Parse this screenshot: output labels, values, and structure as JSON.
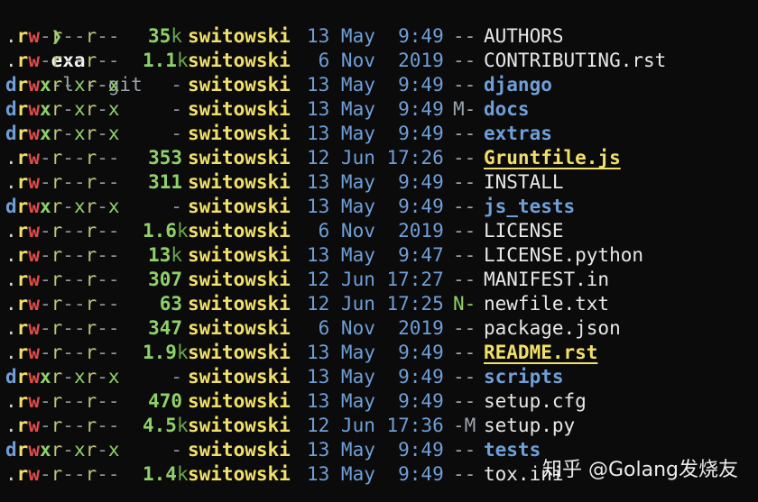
{
  "prompt": {
    "symbol": "❯",
    "command": "exa",
    "args": "-l --git"
  },
  "rows": [
    {
      "type": ".",
      "perms": "rw-r--r--",
      "size": "35",
      "unit": "k",
      "user": "switowski",
      "date": "13 May  9:49",
      "git": "--",
      "name": "AUTHORS",
      "kind": "file"
    },
    {
      "type": ".",
      "perms": "rw-r--r--",
      "size": "1.1",
      "unit": "k",
      "user": "switowski",
      "date": " 6 Nov  2019",
      "git": "--",
      "name": "CONTRIBUTING.rst",
      "kind": "file"
    },
    {
      "type": "d",
      "perms": "rwxr-xr-x",
      "size": "-",
      "unit": "",
      "user": "switowski",
      "date": "13 May  9:49",
      "git": "--",
      "name": "django",
      "kind": "dir"
    },
    {
      "type": "d",
      "perms": "rwxr-xr-x",
      "size": "-",
      "unit": "",
      "user": "switowski",
      "date": "13 May  9:49",
      "git": "M-",
      "name": "docs",
      "kind": "dir"
    },
    {
      "type": "d",
      "perms": "rwxr-xr-x",
      "size": "-",
      "unit": "",
      "user": "switowski",
      "date": "13 May  9:49",
      "git": "--",
      "name": "extras",
      "kind": "dir"
    },
    {
      "type": ".",
      "perms": "rw-r--r--",
      "size": "353",
      "unit": "",
      "user": "switowski",
      "date": "12 Jun 17:26",
      "git": "--",
      "name": "Gruntfile.js",
      "kind": "special"
    },
    {
      "type": ".",
      "perms": "rw-r--r--",
      "size": "311",
      "unit": "",
      "user": "switowski",
      "date": "13 May  9:49",
      "git": "--",
      "name": "INSTALL",
      "kind": "file"
    },
    {
      "type": "d",
      "perms": "rwxr-xr-x",
      "size": "-",
      "unit": "",
      "user": "switowski",
      "date": "13 May  9:49",
      "git": "--",
      "name": "js_tests",
      "kind": "dir"
    },
    {
      "type": ".",
      "perms": "rw-r--r--",
      "size": "1.6",
      "unit": "k",
      "user": "switowski",
      "date": " 6 Nov  2019",
      "git": "--",
      "name": "LICENSE",
      "kind": "file"
    },
    {
      "type": ".",
      "perms": "rw-r--r--",
      "size": "13",
      "unit": "k",
      "user": "switowski",
      "date": "13 May  9:47",
      "git": "--",
      "name": "LICENSE.python",
      "kind": "file"
    },
    {
      "type": ".",
      "perms": "rw-r--r--",
      "size": "307",
      "unit": "",
      "user": "switowski",
      "date": "12 Jun 17:27",
      "git": "--",
      "name": "MANIFEST.in",
      "kind": "file"
    },
    {
      "type": ".",
      "perms": "rw-r--r--",
      "size": "63",
      "unit": "",
      "user": "switowski",
      "date": "12 Jun 17:25",
      "git": "N-",
      "name": "newfile.txt",
      "kind": "file"
    },
    {
      "type": ".",
      "perms": "rw-r--r--",
      "size": "347",
      "unit": "",
      "user": "switowski",
      "date": " 6 Nov  2019",
      "git": "--",
      "name": "package.json",
      "kind": "file"
    },
    {
      "type": ".",
      "perms": "rw-r--r--",
      "size": "1.9",
      "unit": "k",
      "user": "switowski",
      "date": "13 May  9:49",
      "git": "--",
      "name": "README.rst",
      "kind": "special"
    },
    {
      "type": "d",
      "perms": "rwxr-xr-x",
      "size": "-",
      "unit": "",
      "user": "switowski",
      "date": "13 May  9:49",
      "git": "--",
      "name": "scripts",
      "kind": "dir"
    },
    {
      "type": ".",
      "perms": "rw-r--r--",
      "size": "470",
      "unit": "",
      "user": "switowski",
      "date": "13 May  9:49",
      "git": "--",
      "name": "setup.cfg",
      "kind": "file"
    },
    {
      "type": ".",
      "perms": "rw-r--r--",
      "size": "4.5",
      "unit": "k",
      "user": "switowski",
      "date": "12 Jun 17:36",
      "git": "-M",
      "name": "setup.py",
      "kind": "file"
    },
    {
      "type": "d",
      "perms": "rwxr-xr-x",
      "size": "-",
      "unit": "",
      "user": "switowski",
      "date": "13 May  9:49",
      "git": "--",
      "name": "tests",
      "kind": "dir"
    },
    {
      "type": ".",
      "perms": "rw-r--r--",
      "size": "1.4",
      "unit": "k",
      "user": "switowski",
      "date": "13 May  9:49",
      "git": "--",
      "name": "tox.ini",
      "kind": "file"
    }
  ],
  "watermark": "知乎 @Golang发烧友"
}
